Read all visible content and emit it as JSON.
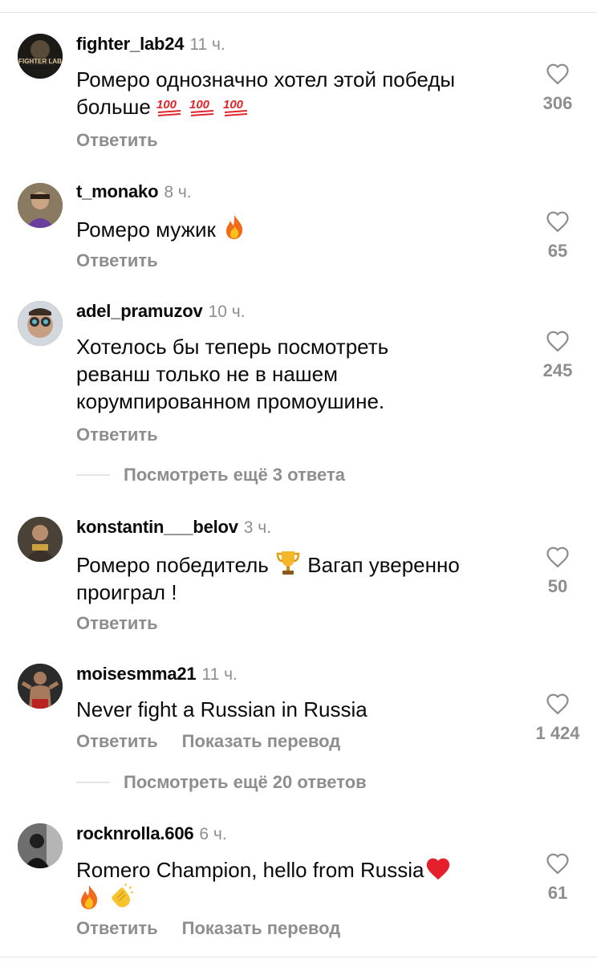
{
  "comments": [
    {
      "username": "fighter_lab24",
      "time": "11 ч.",
      "text_line1": "Ромеро однозначно хотел этой победы",
      "text_line2": "больше",
      "emojis": [
        "hundred-points",
        "hundred-points",
        "hundred-points"
      ],
      "likes": "306",
      "reply": "Ответить"
    },
    {
      "username": "t_monako",
      "time": "8 ч.",
      "text": "Ромеро мужик",
      "emojis": [
        "fire"
      ],
      "likes": "65",
      "reply": "Ответить"
    },
    {
      "username": "adel_pramuzov",
      "time": "10 ч.",
      "text_line1": "Хотелось бы теперь посмотреть",
      "text_line2": "реванш только не в нашем",
      "text_line3": "корумпированном промоушине.",
      "likes": "245",
      "reply": "Ответить",
      "view_more": "Посмотреть ещё 3 ответа"
    },
    {
      "username": "konstantin___belov",
      "time": "3 ч.",
      "text_before": "Ромеро победитель",
      "emojis": [
        "trophy"
      ],
      "text_after": "Вагап уверенно",
      "text_line2": "проиграл !",
      "likes": "50",
      "reply": "Ответить"
    },
    {
      "username": "moisesmma21",
      "time": "11 ч.",
      "text": "Never fight a Russian in Russia",
      "likes": "1 424",
      "reply": "Ответить",
      "translate": "Показать перевод",
      "view_more": "Посмотреть ещё 20 ответов"
    },
    {
      "username": "rocknrolla.606",
      "time": "6 ч.",
      "text_line1": "Romero Champion, hello from Russia",
      "emojis": [
        "red-heart",
        "fire",
        "clapping-hands"
      ],
      "likes": "61",
      "reply": "Ответить",
      "translate": "Показать перевод"
    }
  ],
  "colors": {
    "text": "#0a0a0a",
    "secondary": "#8e8e8e",
    "divider": "#e4e4e4",
    "heart_outline": "#8e8e8e"
  },
  "icons": {
    "like": "heart-outline-icon"
  }
}
